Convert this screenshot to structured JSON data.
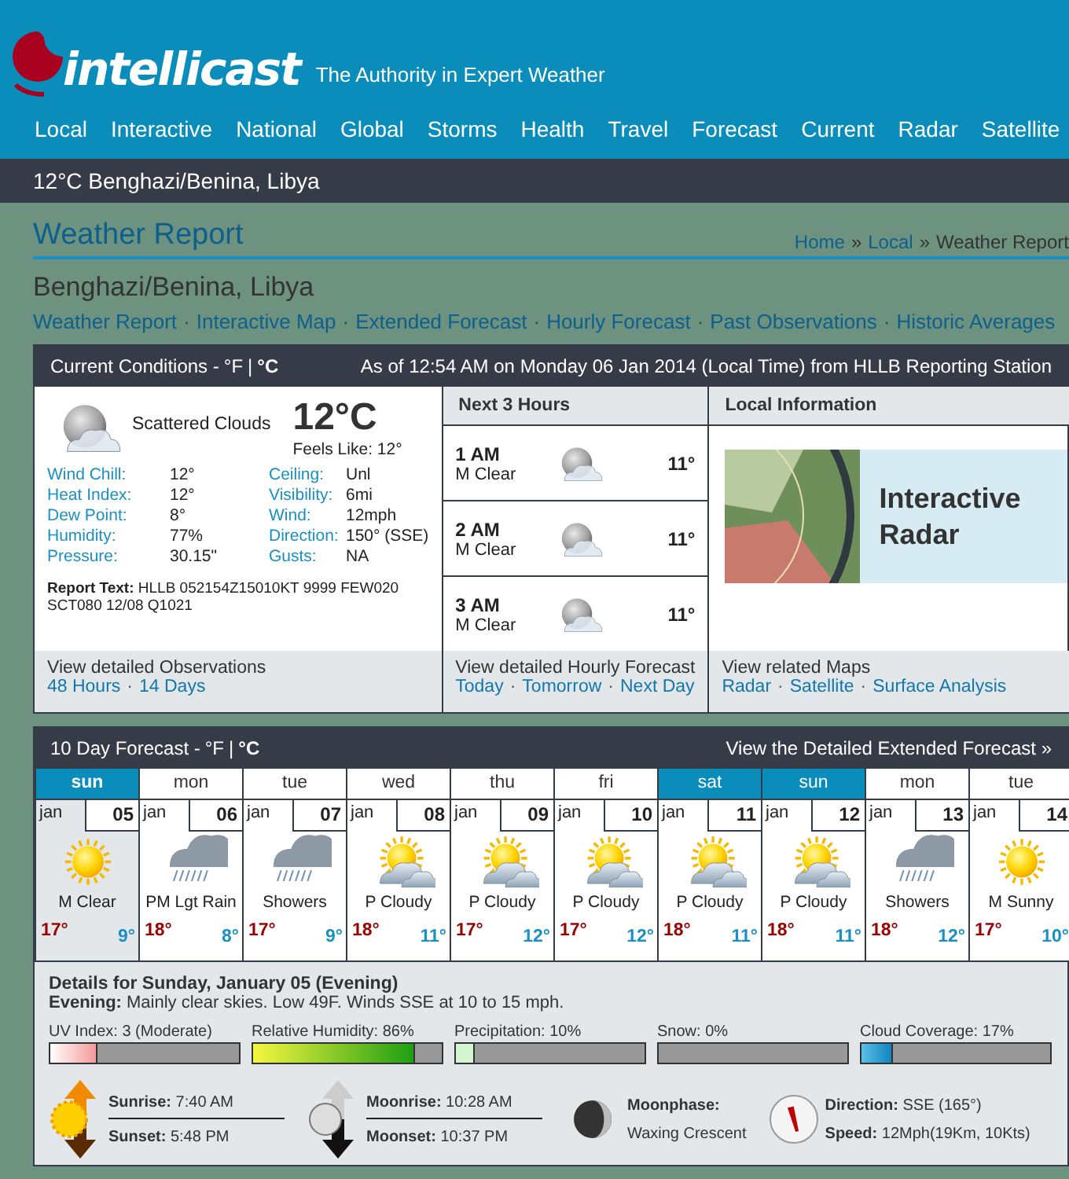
{
  "header": {
    "logo": "intellicast",
    "tagline": "The Authority in Expert Weather",
    "nav": [
      "Local",
      "Interactive",
      "National",
      "Global",
      "Storms",
      "Health",
      "Travel",
      "Forecast",
      "Current",
      "Radar",
      "Satellite"
    ]
  },
  "location_bar": "12°C Benghazi/Benina, Libya",
  "page": {
    "title": "Weather Report",
    "breadcrumb": [
      "Home",
      "Local",
      "Weather Report"
    ],
    "breadcrumb_separator": "»",
    "location": "Benghazi/Benina, Libya",
    "links": [
      "Weather Report",
      "Interactive Map",
      "Extended Forecast",
      "Hourly Forecast",
      "Past Observations",
      "Historic Averages"
    ],
    "link_separator": "·"
  },
  "conditions": {
    "title": "Current Conditions - ",
    "units": [
      {
        "label": "°F",
        "selected": false
      },
      {
        "label": "°C",
        "selected": true
      }
    ],
    "unit_separator": "|",
    "as_of": "As of 12:54 AM on Monday 06 Jan 2014 (Local Time) from HLLB Reporting Station",
    "sky": "Scattered Clouds",
    "temperature": "12°C",
    "feels_like": "Feels Like: 12°",
    "stats_left": [
      {
        "label": "Wind Chill:",
        "value": "12°"
      },
      {
        "label": "Heat Index:",
        "value": "12°"
      },
      {
        "label": "Dew Point:",
        "value": "8°"
      },
      {
        "label": "Humidity:",
        "value": "77%"
      },
      {
        "label": "Pressure:",
        "value": "30.15\""
      }
    ],
    "stats_right": [
      {
        "label": "Ceiling:",
        "value": "Unl"
      },
      {
        "label": "Visibility:",
        "value": "6mi"
      },
      {
        "label": "Wind:",
        "value": "12mph"
      },
      {
        "label": "Direction:",
        "value": "150° (SSE)"
      },
      {
        "label": "Gusts:",
        "value": "NA"
      }
    ],
    "report": "**Report Text:** HLLB 052154Z15010KT 9999 FEW020 SCT080 12/08 Q1021",
    "footer_title": "View detailed Observations",
    "footer_links": [
      "48 Hours",
      "14 Days"
    ],
    "link_separator": "·"
  },
  "next_hours": {
    "title": "Next 3 Hours",
    "hours": [
      {
        "time": "1 AM",
        "sky": "M Clear",
        "temp": "11°"
      },
      {
        "time": "2 AM",
        "sky": "M Clear",
        "temp": "11°"
      },
      {
        "time": "3 AM",
        "sky": "M Clear",
        "temp": "11°"
      }
    ],
    "footer_title": "View detailed Hourly Forecast",
    "footer_links": [
      "Today",
      "Tomorrow",
      "Next Day"
    ],
    "link_separator": "·"
  },
  "local_info": {
    "title": "Local Information",
    "banner": "Interactive Radar",
    "footer_title": "View related Maps",
    "footer_links": [
      "Radar",
      "Satellite",
      "Surface Analysis"
    ],
    "link_separator": "·"
  },
  "forecast": {
    "title": "10 Day Forecast - ",
    "units": [
      {
        "label": "°F",
        "selected": false
      },
      {
        "label": "°C",
        "selected": true
      }
    ],
    "unit_separator": "|",
    "detail_link": "View the Detailed Extended Forecast »",
    "days": [
      {
        "day": "sun",
        "month": "jan",
        "date": "05",
        "kind": "sun",
        "sky": "M Clear",
        "high": "17°",
        "low": "9°",
        "weekend": true,
        "selected": true
      },
      {
        "day": "mon",
        "month": "jan",
        "date": "06",
        "kind": "showers",
        "sky": "PM Lgt Rain",
        "high": "18°",
        "low": "8°",
        "weekend": false,
        "selected": false
      },
      {
        "day": "tue",
        "month": "jan",
        "date": "07",
        "kind": "showers",
        "sky": "Showers",
        "high": "17°",
        "low": "9°",
        "weekend": false,
        "selected": false
      },
      {
        "day": "wed",
        "month": "jan",
        "date": "08",
        "kind": "partly-cloudy",
        "sky": "P Cloudy",
        "high": "18°",
        "low": "11°",
        "weekend": false,
        "selected": false
      },
      {
        "day": "thu",
        "month": "jan",
        "date": "09",
        "kind": "partly-cloudy",
        "sky": "P Cloudy",
        "high": "17°",
        "low": "12°",
        "weekend": false,
        "selected": false
      },
      {
        "day": "fri",
        "month": "jan",
        "date": "10",
        "kind": "partly-cloudy",
        "sky": "P Cloudy",
        "high": "17°",
        "low": "12°",
        "weekend": false,
        "selected": false
      },
      {
        "day": "sat",
        "month": "jan",
        "date": "11",
        "kind": "partly-cloudy",
        "sky": "P Cloudy",
        "high": "18°",
        "low": "11°",
        "weekend": true,
        "selected": false
      },
      {
        "day": "sun",
        "month": "jan",
        "date": "12",
        "kind": "partly-cloudy",
        "sky": "P Cloudy",
        "high": "18°",
        "low": "11°",
        "weekend": true,
        "selected": false
      },
      {
        "day": "mon",
        "month": "jan",
        "date": "13",
        "kind": "showers",
        "sky": "Showers",
        "high": "18°",
        "low": "12°",
        "weekend": false,
        "selected": false
      },
      {
        "day": "tue",
        "month": "jan",
        "date": "14",
        "kind": "sun",
        "sky": "M Sunny",
        "high": "17°",
        "low": "10°",
        "weekend": false,
        "selected": false
      }
    ]
  },
  "details": {
    "title": "Details for Sunday, January 05 (Evening)",
    "summary": "**Evening:** Mainly clear skies. Low 49F. Winds SSE at 10 to 15 mph.",
    "meters": [
      {
        "label": "UV Index: 3 (Moderate)",
        "level": 0.25,
        "kind": "uv"
      },
      {
        "label": "Relative Humidity: 86%",
        "level": 0.86,
        "kind": "humidity"
      },
      {
        "label": "Precipitation: 10%",
        "level": 0.1,
        "kind": "precip"
      },
      {
        "label": "Snow: 0%",
        "level": 0,
        "kind": "snow"
      },
      {
        "label": "Cloud Coverage: 17%",
        "level": 0.17,
        "kind": "cloud"
      }
    ],
    "almanac": [
      {
        "kind": "sun",
        "rows": [
          "**Sunrise:** 7:40 AM",
          "**Sunset:** 5:48 PM"
        ]
      },
      {
        "kind": "moon",
        "rows": [
          "**Moonrise:** 10:28 AM",
          "**Moonset:** 10:37 PM"
        ]
      },
      {
        "kind": "moonphase",
        "rows": [
          "**Moonphase:**",
          "Waxing Crescent"
        ]
      },
      {
        "kind": "wind",
        "rows": [
          "**Direction:** SSE (165°)",
          "**Speed:** 12Mph(19Km, 10Kts)"
        ]
      }
    ]
  }
}
